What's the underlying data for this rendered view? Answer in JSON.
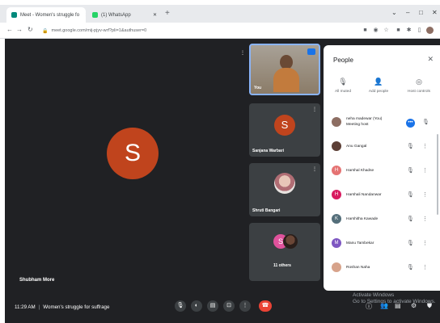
{
  "browser": {
    "tabs": [
      {
        "title": "Meet - Women's struggle fo",
        "favicon_color": "#00897b"
      },
      {
        "title": "(1) WhatsApp",
        "favicon_color": "#25d366"
      }
    ],
    "new_tab": "+",
    "window_controls": [
      "⌄",
      "–",
      "□",
      "✕"
    ],
    "url": "meet.google.com/mij-pjyv-wrf?pli=1&authuser=0"
  },
  "meet": {
    "main_tile": {
      "initial": "S",
      "name": "Shubham More",
      "avatar_color": "#c0441d"
    },
    "tiles": [
      {
        "name": "You"
      },
      {
        "name": "Sanjana Warbari",
        "initial": "S",
        "avatar_color": "#c0441d"
      },
      {
        "name": "Shruti Bangari"
      },
      {
        "name": "11 others",
        "initial": "S",
        "avatar_color": "#e0529c"
      }
    ],
    "bottom": {
      "time": "11:29 AM",
      "meeting_title": "Women's struggle for suffrage"
    },
    "watermark": {
      "line1": "Activate Windows",
      "line2": "Go to Settings to activate Windows."
    }
  },
  "people": {
    "title": "People",
    "actions": [
      {
        "label": "All muted",
        "icon": "mic-off-icon"
      },
      {
        "label": "Add people",
        "icon": "add-person-icon"
      },
      {
        "label": "Host controls",
        "icon": "host-controls-icon"
      }
    ],
    "participants": [
      {
        "name": "neha madewar (You)",
        "sub": "Meeting host",
        "color": "#8d6e63",
        "speaking": true
      },
      {
        "name": "Anu Gangal",
        "color": "#5d4037"
      },
      {
        "name": "Harshal Khadse",
        "color": "#e57373",
        "initial": "H"
      },
      {
        "name": "Harshali Nandanwar",
        "color": "#d81b60",
        "initial": "H"
      },
      {
        "name": "Harshitha Kawade",
        "color": "#546e7a",
        "initial": "K"
      },
      {
        "name": "Manu Tambekar",
        "color": "#7e57c2",
        "initial": "M"
      },
      {
        "name": "Roshan Naha",
        "color": "#d7a38b"
      }
    ]
  }
}
